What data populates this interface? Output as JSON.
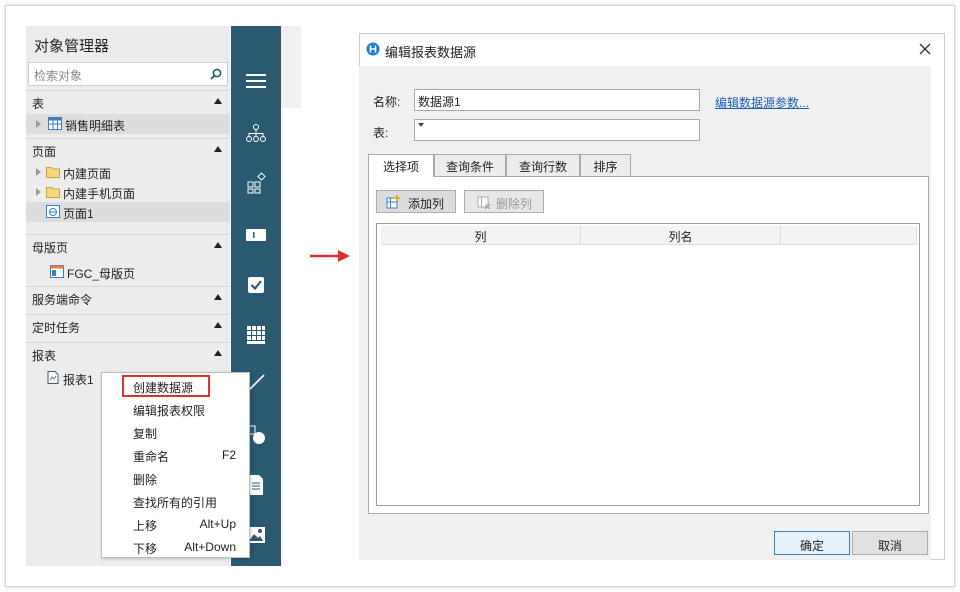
{
  "object_manager": {
    "title": "对象管理器",
    "search_placeholder": "检索对象",
    "sections": {
      "table": "表",
      "page": "页面",
      "master": "母版页",
      "server_cmd": "服务端命令",
      "timed_task": "定时任务",
      "report": "报表"
    },
    "items": {
      "sales_detail": "销售明细表",
      "builtin_page": "内建页面",
      "builtin_mobile": "内建手机页面",
      "page1": "页面1",
      "fgc_master": "FGC_母版页",
      "report1": "报表1"
    }
  },
  "context_menu": {
    "items": [
      {
        "label": "创建数据源",
        "shortcut": ""
      },
      {
        "label": "编辑报表权限",
        "shortcut": ""
      },
      {
        "label": "复制",
        "shortcut": ""
      },
      {
        "label": "重命名",
        "shortcut": "F2"
      },
      {
        "label": "删除",
        "shortcut": ""
      },
      {
        "label": "查找所有的引用",
        "shortcut": ""
      },
      {
        "label": "上移",
        "shortcut": "Alt+Up"
      },
      {
        "label": "下移",
        "shortcut": "Alt+Down"
      }
    ]
  },
  "dialog": {
    "title": "编辑报表数据源",
    "name_label": "名称:",
    "name_value": "数据源1",
    "table_label": "表:",
    "table_value": "",
    "edit_params_link": "编辑数据源参数...",
    "tabs": [
      "选择项",
      "查询条件",
      "查询行数",
      "排序"
    ],
    "add_column": "添加列",
    "delete_column": "删除列",
    "columns": [
      "列",
      "列名"
    ],
    "ok": "确定",
    "cancel": "取消"
  },
  "colors": {
    "toolbar": "#2a5a70",
    "highlight": "#e03030",
    "link": "#1a5fb4",
    "arrow": "#d9342b"
  }
}
